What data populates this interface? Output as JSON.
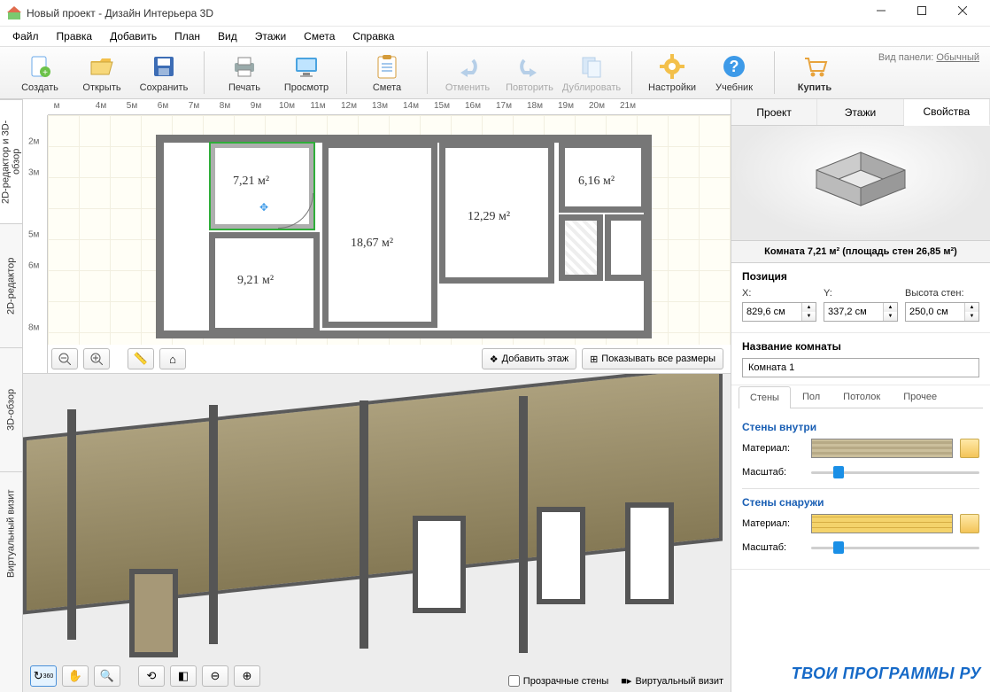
{
  "window": {
    "title": "Новый проект - Дизайн Интерьера 3D"
  },
  "menu": [
    "Файл",
    "Правка",
    "Добавить",
    "План",
    "Вид",
    "Этажи",
    "Смета",
    "Справка"
  ],
  "toolbar": {
    "create": "Создать",
    "open": "Открыть",
    "save": "Сохранить",
    "print": "Печать",
    "preview": "Просмотр",
    "estimate": "Смета",
    "undo": "Отменить",
    "redo": "Повторить",
    "duplicate": "Дублировать",
    "settings": "Настройки",
    "tutorial": "Учебник",
    "buy": "Купить",
    "panel_label": "Вид панели:",
    "panel_mode": "Обычный"
  },
  "side_tabs": [
    "2D-редактор и 3D-обзор",
    "2D-редактор",
    "3D-обзор",
    "Виртуальный визит"
  ],
  "ruler_h": [
    "м",
    "4м",
    "5м",
    "6м",
    "7м",
    "8м",
    "9м",
    "10м",
    "11м",
    "12м",
    "13м",
    "14м",
    "15м",
    "16м",
    "17м",
    "18м",
    "19м",
    "20м",
    "21м"
  ],
  "ruler_v": [
    "2м",
    "3м",
    "5м",
    "6м",
    "8м"
  ],
  "rooms": {
    "r1": "7,21 м²",
    "r2": "18,67 м²",
    "r3": "12,29 м²",
    "r4": "6,16 м²",
    "r5": "9,21 м²"
  },
  "plan_buttons": {
    "add_floor": "Добавить этаж",
    "show_dims": "Показывать все размеры"
  },
  "render_opts": {
    "transparent": "Прозрачные стены",
    "virtual": "Виртуальный визит"
  },
  "ptabs": [
    "Проект",
    "Этажи",
    "Свойства"
  ],
  "room_info": "Комната 7,21 м²  (площадь стен 26,85 м²)",
  "position": {
    "hdr": "Позиция",
    "x_label": "X:",
    "y_label": "Y:",
    "h_label": "Высота стен:",
    "x": "829,6 см",
    "y": "337,2 см",
    "h": "250,0 см"
  },
  "room_name": {
    "hdr": "Название комнаты",
    "value": "Комната 1"
  },
  "subtabs": [
    "Стены",
    "Пол",
    "Потолок",
    "Прочее"
  ],
  "walls": {
    "inside_hdr": "Стены внутри",
    "outside_hdr": "Стены снаружи",
    "material": "Материал:",
    "scale": "Масштаб:"
  },
  "watermark": "ТВОИ ПРОГРАММЫ РУ"
}
